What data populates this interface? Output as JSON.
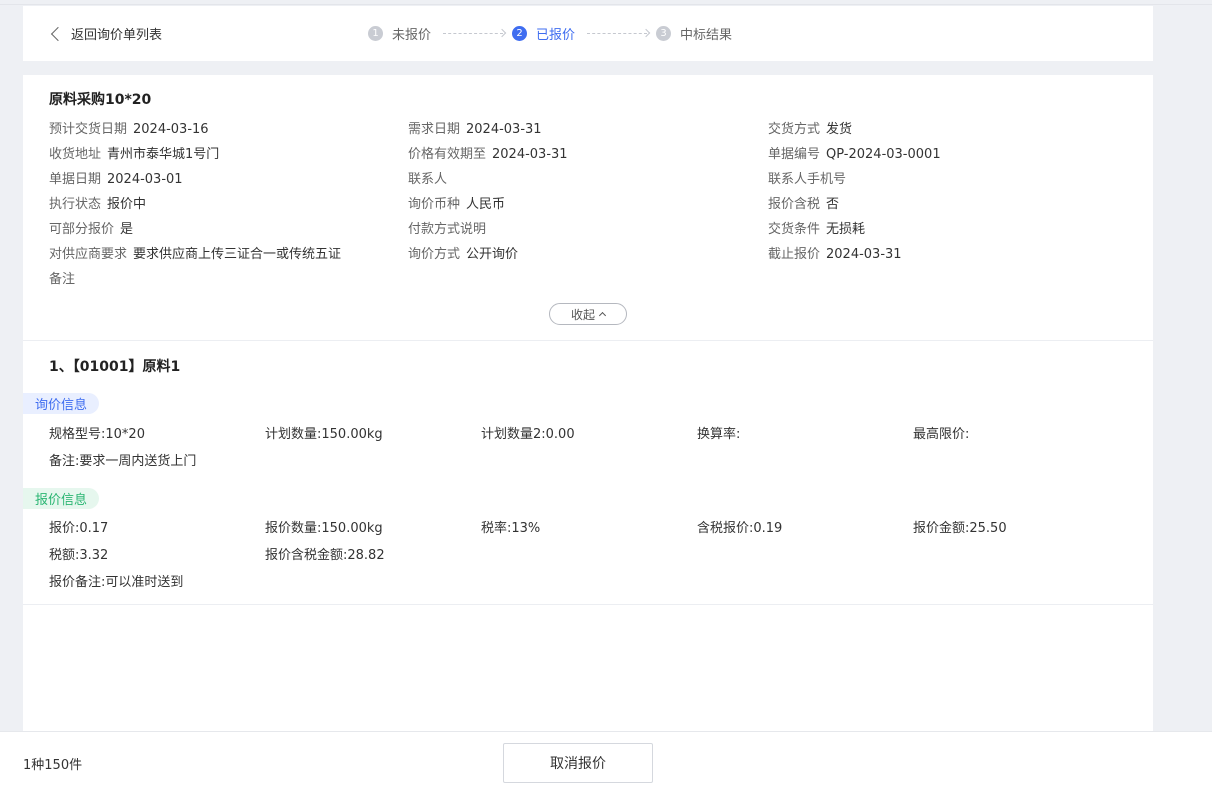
{
  "header": {
    "back_label": "返回询价单列表",
    "steps": [
      {
        "num": "1",
        "label": "未报价"
      },
      {
        "num": "2",
        "label": "已报价"
      },
      {
        "num": "3",
        "label": "中标结果"
      }
    ]
  },
  "document": {
    "title": "原料采购10*20",
    "rows": [
      [
        {
          "label": "预计交货日期",
          "value": "2024-03-16"
        },
        {
          "label": "需求日期",
          "value": "2024-03-31"
        },
        {
          "label": "交货方式",
          "value": "发货"
        }
      ],
      [
        {
          "label": "收货地址",
          "value": "青州市泰华城1号门"
        },
        {
          "label": "价格有效期至",
          "value": "2024-03-31"
        },
        {
          "label": "单据编号",
          "value": "QP-2024-03-0001"
        }
      ],
      [
        {
          "label": "单据日期",
          "value": "2024-03-01"
        },
        {
          "label": "联系人",
          "value": ""
        },
        {
          "label": "联系人手机号",
          "value": ""
        }
      ],
      [
        {
          "label": "执行状态",
          "value": "报价中"
        },
        {
          "label": "询价币种",
          "value": "人民币"
        },
        {
          "label": "报价含税",
          "value": "否"
        }
      ],
      [
        {
          "label": "可部分报价",
          "value": "是"
        },
        {
          "label": "付款方式说明",
          "value": ""
        },
        {
          "label": "交货条件",
          "value": "无损耗"
        }
      ],
      [
        {
          "label": "对供应商要求",
          "value": "要求供应商上传三证合一或传统五证"
        },
        {
          "label": "询价方式",
          "value": "公开询价"
        },
        {
          "label": "截止报价",
          "value": "2024-03-31"
        }
      ],
      [
        {
          "label": "备注",
          "value": ""
        },
        {
          "label": "",
          "value": ""
        },
        {
          "label": "",
          "value": ""
        }
      ]
    ],
    "collapse_label": "收起"
  },
  "item": {
    "title": "1、【01001】原料1",
    "inquiry_tag": "询价信息",
    "inquiry_rows": [
      [
        "规格型号:10*20",
        "计划数量:150.00kg",
        "计划数量2:0.00",
        "换算率:",
        "最高限价:"
      ],
      [
        "备注:要求一周内送货上门",
        "",
        "",
        "",
        ""
      ]
    ],
    "quote_tag": "报价信息",
    "quote_rows": [
      [
        "报价:0.17",
        "报价数量:150.00kg",
        "税率:13%",
        "含税报价:0.19",
        "报价金额:25.50"
      ],
      [
        "税额:3.32",
        "报价含税金额:28.82",
        "",
        "",
        ""
      ],
      [
        "报价备注:可以准时送到",
        "",
        "",
        "",
        ""
      ]
    ]
  },
  "footer": {
    "summary": "1种150件",
    "cancel_label": "取消报价"
  }
}
